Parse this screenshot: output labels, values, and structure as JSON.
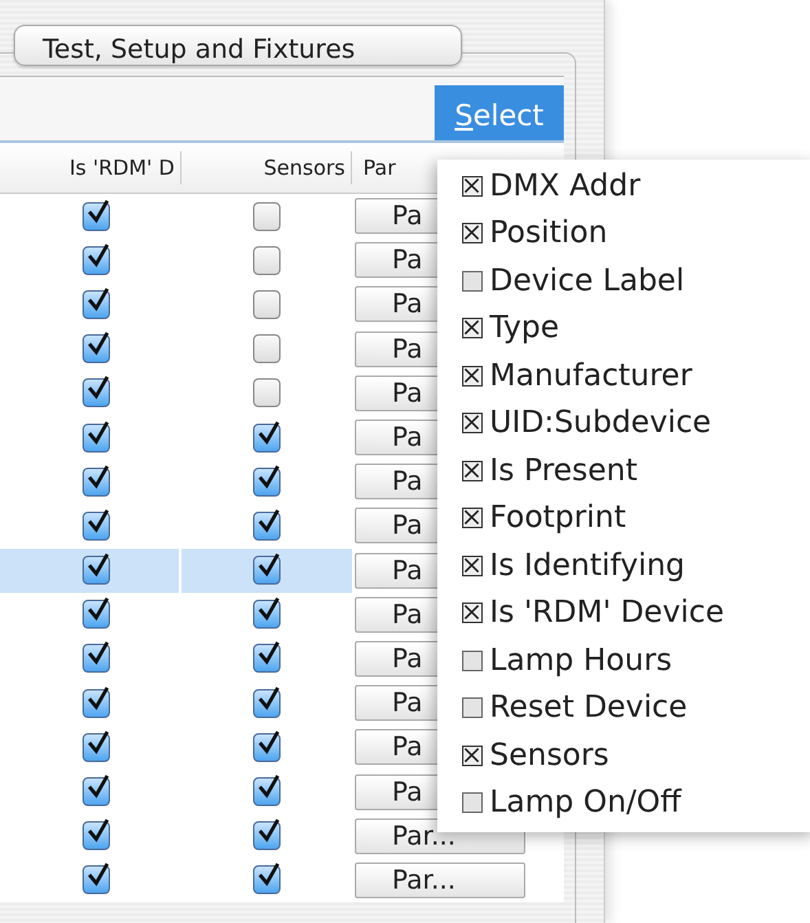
{
  "tab": {
    "label": "Test, Setup and Fixtures",
    "selected": true
  },
  "select_button": {
    "label": "Select",
    "pressed": true
  },
  "table": {
    "columns": [
      "Is 'RDM' D",
      "Sensors",
      "Par"
    ],
    "rows": [
      {
        "is_rdm": true,
        "sensors": false,
        "button": "Pa",
        "selected": false
      },
      {
        "is_rdm": true,
        "sensors": false,
        "button": "Pa",
        "selected": false
      },
      {
        "is_rdm": true,
        "sensors": false,
        "button": "Pa",
        "selected": false
      },
      {
        "is_rdm": true,
        "sensors": false,
        "button": "Pa",
        "selected": false
      },
      {
        "is_rdm": true,
        "sensors": false,
        "button": "Pa",
        "selected": false
      },
      {
        "is_rdm": true,
        "sensors": true,
        "button": "Pa",
        "selected": false
      },
      {
        "is_rdm": true,
        "sensors": true,
        "button": "Pa",
        "selected": false
      },
      {
        "is_rdm": true,
        "sensors": true,
        "button": "Pa",
        "selected": false
      },
      {
        "is_rdm": true,
        "sensors": true,
        "button": "Pa",
        "selected": true
      },
      {
        "is_rdm": true,
        "sensors": true,
        "button": "Pa",
        "selected": false
      },
      {
        "is_rdm": true,
        "sensors": true,
        "button": "Pa",
        "selected": false
      },
      {
        "is_rdm": true,
        "sensors": true,
        "button": "Pa",
        "selected": false
      },
      {
        "is_rdm": true,
        "sensors": true,
        "button": "Pa",
        "selected": false
      },
      {
        "is_rdm": true,
        "sensors": true,
        "button": "Pa",
        "selected": false
      },
      {
        "is_rdm": true,
        "sensors": true,
        "button": "Par...",
        "selected": false
      },
      {
        "is_rdm": true,
        "sensors": true,
        "button": "Par...",
        "selected": false
      }
    ]
  },
  "menu": {
    "items": [
      {
        "label": "DMX Addr",
        "checked": true
      },
      {
        "label": "Position",
        "checked": true
      },
      {
        "label": "Device Label",
        "checked": false
      },
      {
        "label": "Type",
        "checked": true
      },
      {
        "label": "Manufacturer",
        "checked": true
      },
      {
        "label": "UID:Subdevice",
        "checked": true
      },
      {
        "label": "Is Present",
        "checked": true
      },
      {
        "label": "Footprint",
        "checked": true
      },
      {
        "label": "Is Identifying",
        "checked": true
      },
      {
        "label": "Is 'RDM' Device",
        "checked": true
      },
      {
        "label": "Lamp Hours",
        "checked": false
      },
      {
        "label": "Reset Device",
        "checked": false
      },
      {
        "label": "Sensors",
        "checked": true
      },
      {
        "label": "Lamp On/Off",
        "checked": false
      }
    ]
  }
}
